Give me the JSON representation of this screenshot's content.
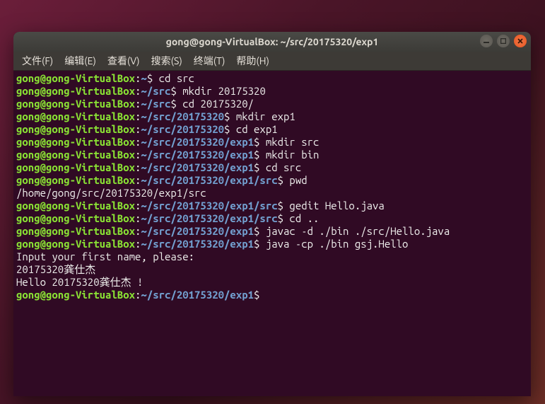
{
  "titlebar": {
    "title": "gong@gong-VirtualBox: ~/src/20175320/exp1"
  },
  "menu": {
    "file": "文件(F)",
    "edit": "编辑(E)",
    "view": "查看(V)",
    "search": "搜索(S)",
    "term": "终端(T)",
    "help": "帮助(H)"
  },
  "prompt": {
    "userhost": "gong@gong-VirtualBox",
    "colon": ":",
    "dollar": "$ "
  },
  "lines": [
    {
      "path": "~",
      "cmd": "cd src"
    },
    {
      "path": "~/src",
      "cmd": "mkdir 20175320"
    },
    {
      "path": "~/src",
      "cmd": "cd 20175320/"
    },
    {
      "path": "~/src/20175320",
      "cmd": "mkdir exp1"
    },
    {
      "path": "~/src/20175320",
      "cmd": "cd exp1"
    },
    {
      "path": "~/src/20175320/exp1",
      "cmd": "mkdir src"
    },
    {
      "path": "~/src/20175320/exp1",
      "cmd": "mkdir bin"
    },
    {
      "path": "~/src/20175320/exp1",
      "cmd": "cd src"
    },
    {
      "path": "~/src/20175320/exp1/src",
      "cmd": "pwd"
    }
  ],
  "output1": "/home/gong/src/20175320/exp1/src",
  "lines2": [
    {
      "path": "~/src/20175320/exp1/src",
      "cmd": "gedit Hello.java"
    },
    {
      "path": "~/src/20175320/exp1/src",
      "cmd": "cd .."
    },
    {
      "path": "~/src/20175320/exp1",
      "cmd": "javac -d ./bin ./src/Hello.java"
    },
    {
      "path": "~/src/20175320/exp1",
      "cmd": "java -cp ./bin gsj.Hello"
    }
  ],
  "output2": {
    "l1": "Input your first name, please:",
    "l2": "20175320龚仕杰",
    "l3": "Hello 20175320龚仕杰 !"
  },
  "last": {
    "path": "~/src/20175320/exp1",
    "cmd": ""
  }
}
